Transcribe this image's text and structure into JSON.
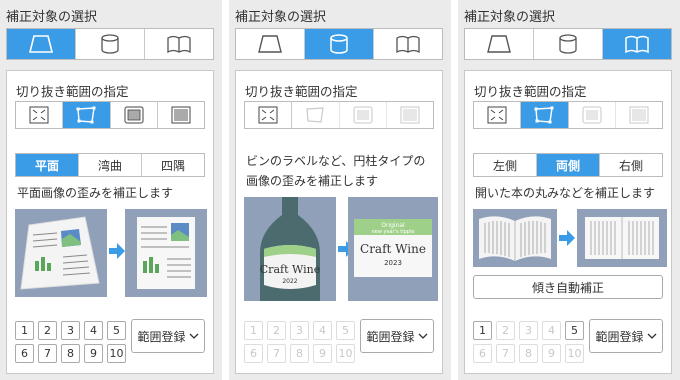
{
  "panels": [
    {
      "title": "補正対象の選択",
      "selected_target": "flat",
      "crop_label": "切り抜き範囲の指定",
      "subtabs": [
        "平面",
        "湾曲",
        "四隅"
      ],
      "description": "平面画像の歪みを補正します",
      "pages_row1": [
        "1",
        "2",
        "3",
        "4",
        "5"
      ],
      "pages_row2": [
        "6",
        "7",
        "8",
        "9",
        "10"
      ],
      "register_label": "範囲登録"
    },
    {
      "title": "補正対象の選択",
      "selected_target": "cylinder",
      "crop_label": "切り抜き範囲の指定",
      "description_line1": "ビンのラベルなど、円柱タイプの",
      "description_line2": "画像の歪みを補正します",
      "bottle_label_text": "Craft Wine",
      "bottle_label_year": "2022",
      "wine_label_header1": "Original",
      "wine_label_header2": "new year's tipple",
      "wine_label_title": "Craft Wine",
      "wine_label_year": "2023",
      "pages_row1": [
        "1",
        "2",
        "3",
        "4",
        "5"
      ],
      "pages_row2": [
        "6",
        "7",
        "8",
        "9",
        "10"
      ],
      "register_label": "範囲登録"
    },
    {
      "title": "補正対象の選択",
      "selected_target": "book",
      "crop_label": "切り抜き範囲の指定",
      "subtabs": [
        "左側",
        "両側",
        "右側"
      ],
      "description": "開いた本の丸みなどを補正します",
      "auto_tilt_label": "傾き自動補正",
      "pages_row1": [
        "1",
        "2",
        "3",
        "4",
        "5"
      ],
      "pages_row2": [
        "6",
        "7",
        "8",
        "9",
        "10"
      ],
      "register_label": "範囲登録"
    }
  ],
  "colors": {
    "accent": "#3a9be6",
    "panel_bg": "#ebebeb",
    "illustration_bg": "#8fa0b8"
  }
}
